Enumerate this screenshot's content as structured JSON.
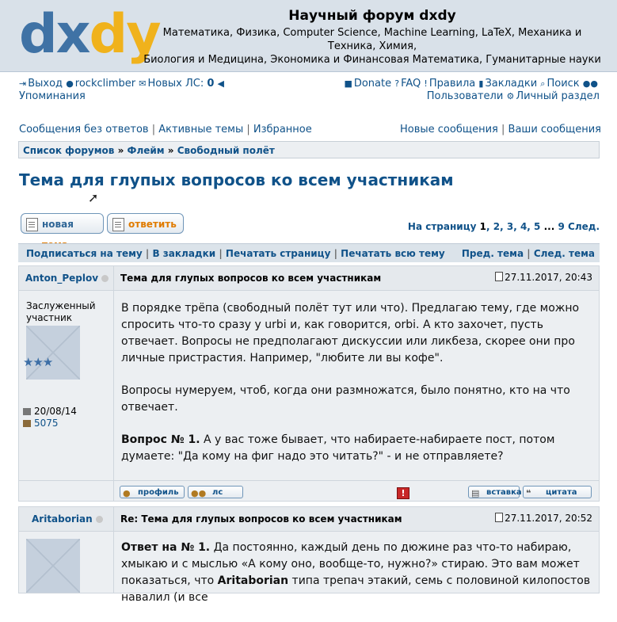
{
  "header": {
    "logo_a": "dx",
    "logo_b": "dy",
    "title": "Научный форум dxdy",
    "desc_line1": "Математика, Физика, Computer Science, Machine Learning, LaTeX, Механика и",
    "desc_line2": "Техника, Химия,",
    "desc_line3": "Биология и Медицина, Экономика и Финансовая Математика, Гуманитарные науки"
  },
  "userbar": {
    "logout": "Выход",
    "username": "rockclimber",
    "new_pm_label": "Новых ЛС:",
    "new_pm_count": "0",
    "mentions": "Упоминания",
    "donate": "Donate",
    "faq": "FAQ",
    "rules": "Правила",
    "bookmarks": "Закладки",
    "search": "Поиск",
    "users": "Пользователи",
    "ucp": "Личный раздел"
  },
  "nav": {
    "unanswered": "Сообщения без ответов",
    "active": "Активные темы",
    "favorites": "Избранное",
    "new_posts": "Новые сообщения",
    "your_posts": "Ваши сообщения"
  },
  "breadcrumb": {
    "a": "Список форумов",
    "sep": "»",
    "b": "Флейм",
    "c": "Свободный полёт"
  },
  "topic": {
    "title": "Тема для глупых вопросов ко всем участникам"
  },
  "buttons": {
    "new_a": "новая",
    "new_b": "тема",
    "reply": "ответить"
  },
  "pager": {
    "label": "На страницу",
    "p1": "1",
    "p2": "2",
    "p3": "3",
    "p4": "4",
    "p5": "5",
    "ell": "...",
    "p9": "9",
    "next": "След."
  },
  "actions": {
    "subscribe": "Подписаться на тему",
    "bookmark": "В закладки",
    "print_page": "Печатать страницу",
    "print_all": "Печатать всю тему",
    "prev_topic": "Пред. тема",
    "next_topic": "След. тема"
  },
  "posts": [
    {
      "author": "Anton_Peplov",
      "subject": "Тема для глупых вопросов ко всем участникам",
      "date": "27.11.2017, 20:43",
      "rank_line1": "Заслуженный",
      "rank_line2": "участник",
      "stars": "★★★",
      "joined": "20/08/14",
      "post_count": "5075",
      "p1": "В порядке трёпа (свободный полёт тут или что). Предлагаю тему, где можно спросить что-то сразу у urbi и, как говорится, orbi. А кто захочет, пусть отвечает. Вопросы не предполагают дискуссии или ликбеза, скорее они про личные пристрастия. Например, \"любите ли вы кофе\".",
      "p2": "Вопросы нумеруем, чтоб, когда они размножатся, было понятно, кто на что отвечает.",
      "p3_bold": "Вопрос № 1.",
      "p3": " А у вас тоже бывает, что набираете-набираете пост, потом думаете: \"Да кому на фиг надо это читать?\" - и не отправляете?",
      "btn_profile": "профиль",
      "btn_pm": "лс",
      "btn_quote_insert": "вставка",
      "btn_quote": "цитата"
    },
    {
      "author": "Aritaborian",
      "subject": "Re: Тема для глупых вопросов ко всем участникам",
      "date": "27.11.2017, 20:52",
      "p1_bold": "Ответ на № 1.",
      "p1": " Да постоянно, каждый день по дюжине раз что-то набираю, хмыкаю и с мыслью «А кому оно, вообще-то, нужно?» стираю. Это вам может показаться, что ",
      "p1_bold2": "Aritaborian",
      "p1_tail": " типа трепач этакий, семь с половиной килопостов навалил (и все"
    }
  ]
}
